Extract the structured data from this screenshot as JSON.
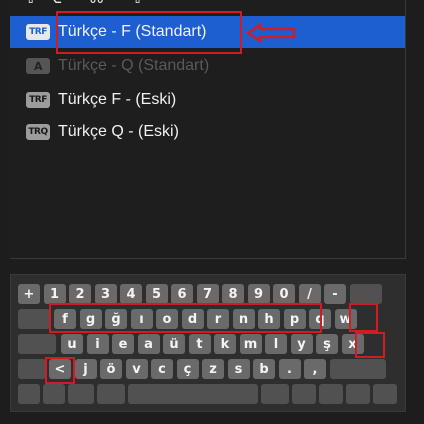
{
  "top_cut_text": "⇧ ⌥ ⌃ ⌘ ⌃ ⇧",
  "input_sources": [
    {
      "badge": "TRF",
      "label": "Türkçe - F (Standart)",
      "selected": true,
      "disabled": false
    },
    {
      "badge": "A",
      "label": "Türkçe - Q (Standart)",
      "selected": false,
      "disabled": true
    },
    {
      "badge": "TRF",
      "label": "Türkçe F - (Eski)",
      "selected": false,
      "disabled": false
    },
    {
      "badge": "TRQ",
      "label": "Türkçe Q - (Eski)",
      "selected": false,
      "disabled": false
    }
  ],
  "annotation": {
    "color": "#d21c24"
  },
  "keyboard": {
    "row1": [
      "+",
      "1",
      "2",
      "3",
      "4",
      "5",
      "6",
      "7",
      "8",
      "9",
      "0",
      "/",
      "-"
    ],
    "row2": [
      "f",
      "g",
      "ğ",
      "ı",
      "o",
      "d",
      "r",
      "n",
      "h",
      "p",
      "q",
      "w"
    ],
    "row3": [
      "u",
      "i",
      "e",
      "a",
      "ü",
      "t",
      "k",
      "m",
      "l",
      "y",
      "ş",
      "x"
    ],
    "row4": [
      "<",
      "j",
      "ö",
      "v",
      "c",
      "ç",
      "z",
      "s",
      "b",
      ".",
      ","
    ]
  },
  "colors": {
    "selection": "#1d5fd0",
    "key": "#6a6a6a",
    "background": "#1e1e1e"
  }
}
